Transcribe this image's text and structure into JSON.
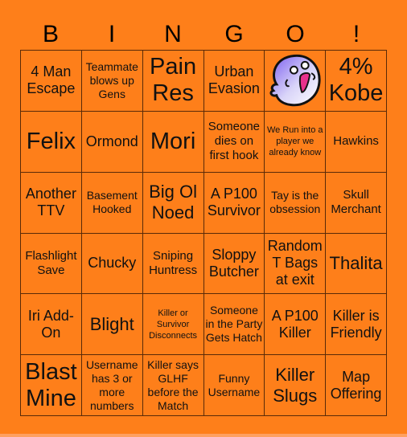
{
  "title_letters": [
    "B",
    "I",
    "N",
    "G",
    "O",
    "!"
  ],
  "colors": {
    "background": "#fe7f1a",
    "grid_line": "#5a2a08",
    "text": "#111111"
  },
  "free_space": {
    "icon": "ghost-emote-icon",
    "row": 0,
    "col": 4
  },
  "cells": [
    [
      "4 Man Escape",
      "Teammate blows up Gens",
      "Pain Res",
      "Urban Evasion",
      "",
      "4% Kobe"
    ],
    [
      "Felix",
      "Ormond",
      "Mori",
      "Someone dies on first hook",
      "We Run into a player we already know",
      "Hawkins"
    ],
    [
      "Another TTV",
      "Basement Hooked",
      "Big Ol Noed",
      "A P100 Survivor",
      "Tay is the obsession",
      "Skull Merchant"
    ],
    [
      "Flashlight Save",
      "Chucky",
      "Sniping Huntress",
      "Sloppy Butcher",
      "Random T Bags at exit",
      "Thalita"
    ],
    [
      "Iri Add-On",
      "Blight",
      "Killer or Survivor Disconnects",
      "Someone in the Party Gets Hatch",
      "A P100 Killer",
      "Killer is Friendly"
    ],
    [
      "Blast Mine",
      "Username has 3 or more numbers",
      "Killer says GLHF before the Match",
      "Funny Username",
      "Killer Slugs",
      "Map Offering"
    ]
  ]
}
